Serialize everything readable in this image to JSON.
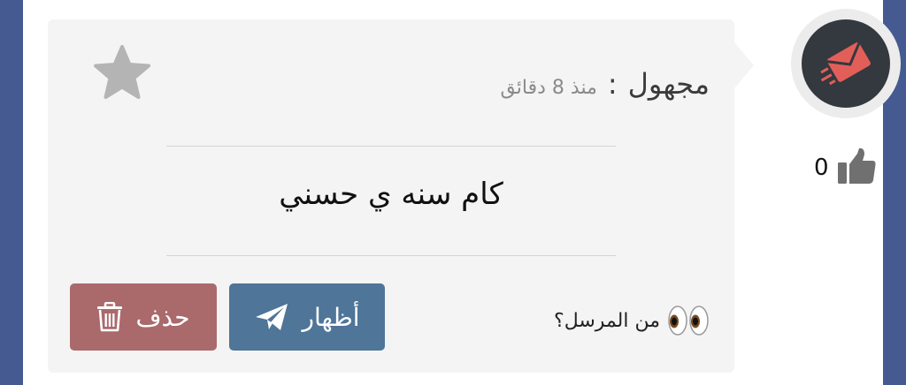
{
  "message": {
    "sender": "مجهول",
    "separator": ":",
    "time": "منذ 8 دقائق",
    "text": "كام سنه ي حسني",
    "who_sent_label": "من المرسل؟"
  },
  "actions": {
    "reveal_label": "أظهار",
    "delete_label": "حذف"
  },
  "likes": {
    "count": "0"
  },
  "icons": {
    "favorite": "star-icon",
    "reveal": "paper-plane-icon",
    "delete": "trash-icon",
    "like": "thumbs-up-icon",
    "eyes": "eyes-icon",
    "avatar": "envelope-logo-icon"
  },
  "colors": {
    "page_background": "#455a91",
    "card_background": "#f4f4f4",
    "reveal_button": "#4f7598",
    "delete_button": "#aa6a6c",
    "star": "#b4b4b4",
    "avatar_background": "#34383f",
    "avatar_accent": "#e25f59"
  }
}
